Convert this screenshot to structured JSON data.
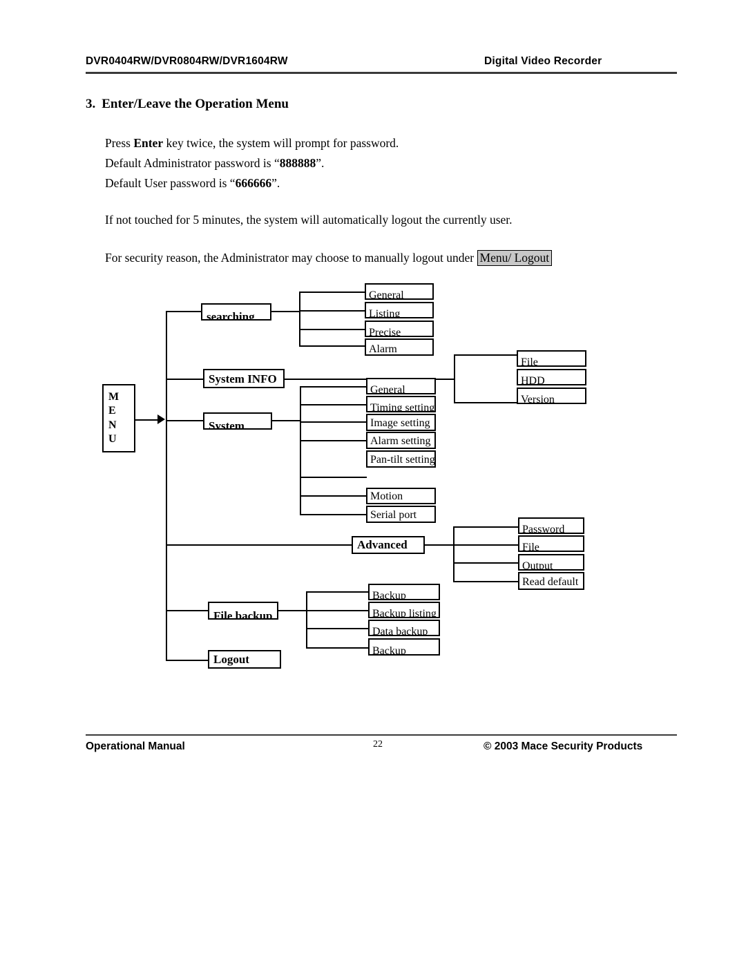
{
  "header": {
    "left": "DVR0404RW/DVR0804RW/DVR1604RW",
    "right": "Digital Video Recorder"
  },
  "section": {
    "number": "3.",
    "title": "Enter/Leave the Operation Menu"
  },
  "body": {
    "p1_a": "Press ",
    "p1_b": "Enter",
    "p1_c": " key twice, the system will prompt for password.",
    "p2_a": "Default Administrator password is “",
    "p2_b": "888888",
    "p2_c": "”.",
    "p3_a": "Default User password is “",
    "p3_b": "666666",
    "p3_c": "”.",
    "p4": "If not touched for 5 minutes, the system will automatically logout the currently user.",
    "p5_a": "For security reason, the Administrator may choose to manually logout under ",
    "p5_box": "Menu/ Logout",
    "p5_box_color": "#c8c8c8"
  },
  "diagram": {
    "root": {
      "label_letters": [
        "M",
        "E",
        "N",
        "U"
      ],
      "label": "MENU"
    },
    "branches": [
      {
        "id": "searching",
        "label": "searching"
      },
      {
        "id": "system-info",
        "label": "System    INFO"
      },
      {
        "id": "system",
        "label": "System"
      },
      {
        "id": "advanced",
        "label": "Advanced"
      },
      {
        "id": "file-backup",
        "label": "File backup"
      },
      {
        "id": "logout",
        "label": "Logout"
      }
    ],
    "searching_children": [
      "General",
      "Listing",
      "Precise",
      "Alarm"
    ],
    "system_info_children": [
      "File",
      "HDD",
      "Version"
    ],
    "system_children": [
      "General",
      "Timing setting",
      "Image setting",
      "Alarm setting",
      "Pan-tilt setting",
      "Motion",
      "Serial port"
    ],
    "advanced_children": [
      "Password",
      "File",
      "Output",
      "Read default"
    ],
    "file_backup_children": [
      "Backup",
      "Backup listing",
      "Data backup",
      "Backup"
    ]
  },
  "footer": {
    "left": "Operational Manual",
    "page": "22",
    "right": "© 2003 Mace Security Products"
  }
}
